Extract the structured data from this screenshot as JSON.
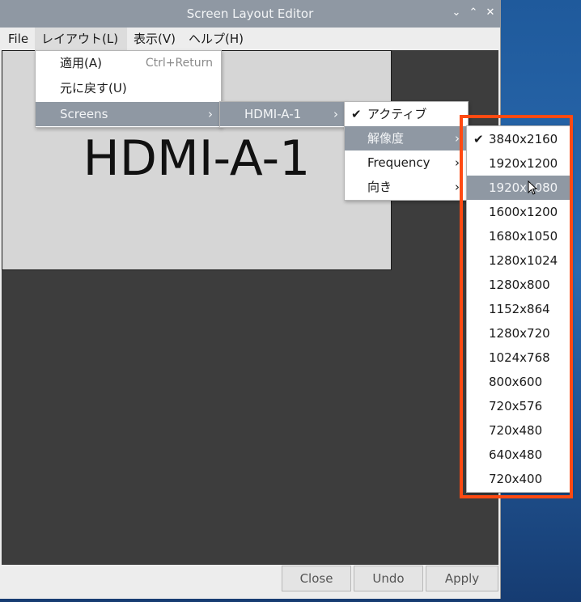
{
  "window": {
    "title": "Screen Layout Editor",
    "controls": {
      "minimize": "⌄",
      "maximize": "⌃",
      "close": "✕"
    }
  },
  "menubar": {
    "items": [
      {
        "label": "File"
      },
      {
        "label": "レイアウト(L)"
      },
      {
        "label": "表示(V)"
      },
      {
        "label": "ヘルプ(H)"
      }
    ]
  },
  "canvas": {
    "screen_label": "HDMI-A-1"
  },
  "layout_menu": {
    "apply": {
      "label": "適用(A)",
      "shortcut": "Ctrl+Return"
    },
    "revert": {
      "label": "元に戻す(U)"
    },
    "screens": {
      "label": "Screens"
    }
  },
  "screens_menu": {
    "items": [
      {
        "label": "HDMI-A-1"
      }
    ]
  },
  "hdmi_menu": {
    "items": [
      {
        "label": "アクティブ",
        "checked": true
      },
      {
        "label": "解像度"
      },
      {
        "label": "Frequency"
      },
      {
        "label": "向き"
      }
    ]
  },
  "resolution_menu": {
    "selected": "3840x2160",
    "hovered": "1920x1080",
    "items": [
      "3840x2160",
      "1920x1200",
      "1920x1080",
      "1600x1200",
      "1680x1050",
      "1280x1024",
      "1280x800",
      "1152x864",
      "1280x720",
      "1024x768",
      "800x600",
      "720x576",
      "720x480",
      "640x480",
      "720x400"
    ]
  },
  "buttons": {
    "close": "Close",
    "undo": "Undo",
    "apply": "Apply"
  },
  "colors": {
    "highlight_border": "#ff4a12",
    "menu_selection": "#8f98a3",
    "canvas": "#3d3d3d"
  },
  "icons": {
    "check": "✔",
    "submenu_arrow": "›"
  }
}
